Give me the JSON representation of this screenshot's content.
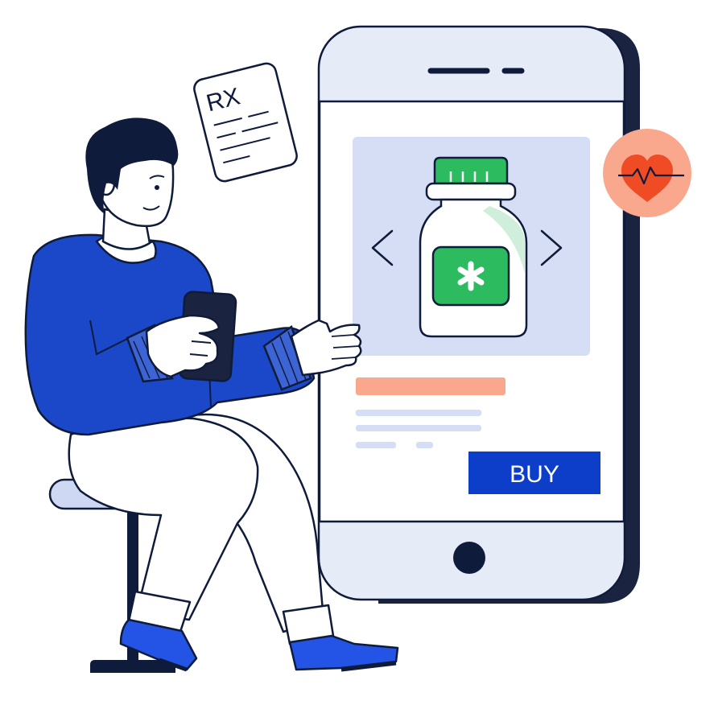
{
  "prescription_note": {
    "label": "RX"
  },
  "product_card": {
    "buy_label": "BUY",
    "carousel": {
      "prev_icon": "chevron-left-icon",
      "next_icon": "chevron-right-icon"
    },
    "product_icon": "medicine-bottle-icon",
    "badge_icon": "asterisk-icon"
  },
  "health_badge": {
    "icon": "heart-pulse-icon"
  },
  "colors": {
    "outline": "#0f1b3a",
    "phone_body": "#e6ebf8",
    "phone_frame": "#1a2440",
    "image_panel": "#d5def4",
    "title_bar": "#f9a88e",
    "text_lines": "#d5def4",
    "buy_button": "#0d3ec9",
    "shirt": "#1a48c9",
    "bottle_cap": "#2dbb5f",
    "heart_badge": "#f9a88e",
    "heart": "#ef4b25",
    "stool_seat": "#cfd8f3"
  }
}
